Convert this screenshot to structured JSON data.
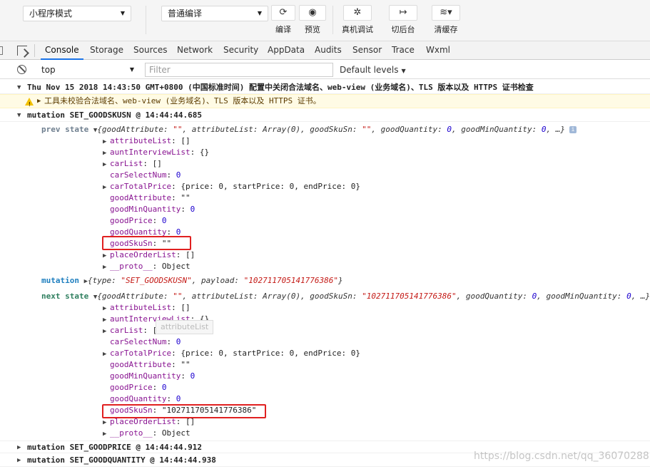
{
  "toolbar": {
    "mode_select": "小程序模式",
    "compile_select": "普通编译",
    "buttons": [
      {
        "label": "编译",
        "icon": "refresh-icon"
      },
      {
        "label": "预览",
        "icon": "eye-icon"
      },
      {
        "label": "真机调试",
        "icon": "bug-icon"
      },
      {
        "label": "切后台",
        "icon": "switch-background-icon"
      },
      {
        "label": "清缓存",
        "icon": "layers-icon"
      }
    ]
  },
  "devtools": {
    "tabs": [
      "Console",
      "Storage",
      "Sources",
      "Network",
      "Security",
      "AppData",
      "Audits",
      "Sensor",
      "Trace",
      "Wxml"
    ],
    "active_tab": "Console"
  },
  "filterbar": {
    "context": "top",
    "filter_placeholder": "Filter",
    "levels": "Default levels"
  },
  "console": {
    "line1": "Thu Nov 15 2018 14:43:50 GMT+0800 (中国标准时间) 配置中关闭合法域名、web-view (业务域名)、TLS 版本以及 HTTPS 证书检查",
    "warning": "工具未校验合法域名、web-view (业务域名)、TLS 版本以及 HTTPS 证书。",
    "group1": "mutation SET_GOODSKUSN @ 14:44:44.685",
    "prev_label": "prev state",
    "prev_summary": {
      "open": "{goodAttribute: ",
      "v1": "\"\"",
      "p2": ", attributeList: Array(0), goodSkuSn: ",
      "v2": "\"\"",
      "p3": ", goodQuantity: ",
      "v3": "0",
      "p4": ", goodMinQuantity: ",
      "v4": "0",
      "tail": ", …}"
    },
    "prev_props": [
      {
        "key": "attributeList",
        "sep": ": ",
        "val": "[]",
        "type": "plain",
        "exp": true
      },
      {
        "key": "auntInterviewList",
        "sep": ": ",
        "val": "{}",
        "type": "plain",
        "exp": true
      },
      {
        "key": "carList",
        "sep": ": ",
        "val": "[]",
        "type": "plain",
        "exp": true
      },
      {
        "key": "carSelectNum",
        "sep": ": ",
        "val": "0",
        "type": "num",
        "exp": false
      },
      {
        "key": "carTotalPrice",
        "sep": ": ",
        "val": "{price: 0, startPrice: 0, endPrice: 0}",
        "type": "plain",
        "exp": true
      },
      {
        "key": "goodAttribute",
        "sep": ": ",
        "val": "\"\"",
        "type": "plain",
        "exp": false
      },
      {
        "key": "goodMinQuantity",
        "sep": ": ",
        "val": "0",
        "type": "num",
        "exp": false
      },
      {
        "key": "goodPrice",
        "sep": ": ",
        "val": "0",
        "type": "num",
        "exp": false
      },
      {
        "key": "goodQuantity",
        "sep": ": ",
        "val": "0",
        "type": "num",
        "exp": false
      },
      {
        "key": "goodSkuSn",
        "sep": ": ",
        "val": "\"\"",
        "type": "plain",
        "exp": false
      },
      {
        "key": "placeOrderList",
        "sep": ": ",
        "val": "[]",
        "type": "plain",
        "exp": true
      },
      {
        "key": "__proto__",
        "sep": ": ",
        "val": "Object",
        "type": "plain",
        "exp": true
      }
    ],
    "mutation_label": "mutation",
    "mutation_summary": {
      "p1": "{type: ",
      "v1": "\"SET_GOODSKUSN\"",
      "p2": ", payload: ",
      "v2": "\"102711705141776386\"",
      "p3": "}"
    },
    "next_label": "next state",
    "next_summary": {
      "open": "{goodAttribute: ",
      "v1": "\"\"",
      "p2": ", attributeList: Array(0), goodSkuSn: ",
      "v2": "\"102711705141776386\"",
      "p3": ", goodQuantity: ",
      "v3": "0",
      "p4": ", goodMinQuantity: ",
      "v4": "0",
      "tail": ", …}"
    },
    "next_props": [
      {
        "key": "attributeList",
        "sep": ": ",
        "val": "[]",
        "type": "plain",
        "exp": true
      },
      {
        "key": "auntInterviewList",
        "sep": ": ",
        "val": "{}",
        "type": "plain",
        "exp": true
      },
      {
        "key": "carList",
        "sep": ": ",
        "val": "[]",
        "type": "plain",
        "exp": true
      },
      {
        "key": "carSelectNum",
        "sep": ": ",
        "val": "0",
        "type": "num",
        "exp": false
      },
      {
        "key": "carTotalPrice",
        "sep": ": ",
        "val": "{price: 0, startPrice: 0, endPrice: 0}",
        "type": "plain",
        "exp": true
      },
      {
        "key": "goodAttribute",
        "sep": ": ",
        "val": "\"\"",
        "type": "plain",
        "exp": false
      },
      {
        "key": "goodMinQuantity",
        "sep": ": ",
        "val": "0",
        "type": "num",
        "exp": false
      },
      {
        "key": "goodPrice",
        "sep": ": ",
        "val": "0",
        "type": "num",
        "exp": false
      },
      {
        "key": "goodQuantity",
        "sep": ": ",
        "val": "0",
        "type": "num",
        "exp": false
      },
      {
        "key": "goodSkuSn",
        "sep": ": ",
        "val": "\"102711705141776386\"",
        "type": "plain",
        "exp": false
      },
      {
        "key": "placeOrderList",
        "sep": ": ",
        "val": "[]",
        "type": "plain",
        "exp": true
      },
      {
        "key": "__proto__",
        "sep": ": ",
        "val": "Object",
        "type": "plain",
        "exp": true
      }
    ],
    "tooltip": "attributeList",
    "group2": "mutation SET_GOODPRICE @ 14:44:44.912",
    "group3": "mutation SET_GOODQUANTITY @ 14:44:44.938"
  },
  "watermark": "https://blog.csdn.net/qq_36070288"
}
